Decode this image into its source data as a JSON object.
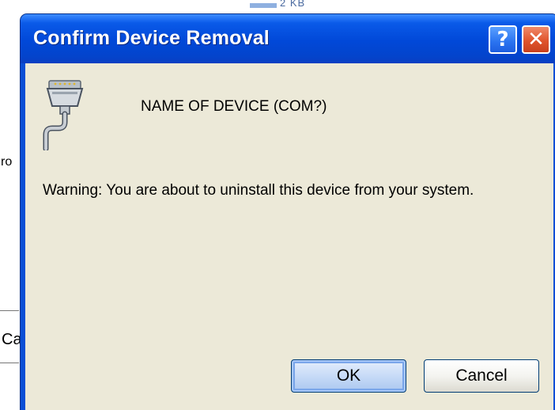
{
  "background": {
    "top_fragment": "2 KB",
    "left_fragment_1": "ro",
    "left_fragment_2": "Ca"
  },
  "dialog": {
    "title": "Confirm Device Removal",
    "help_button_glyph": "?",
    "close_button_glyph": "✕",
    "device_icon": "serial-port-icon",
    "device_name": "NAME OF DEVICE (COM?)",
    "warning_text": "Warning: You are about to uninstall this device from your system.",
    "ok_label": "OK",
    "cancel_label": "Cancel"
  },
  "colors": {
    "titlebar": "#0148d8",
    "client_background": "#ece9d8",
    "close_button": "#e0542c",
    "help_button": "#2a73f0",
    "ok_button_focus": "#7aa6ea"
  }
}
